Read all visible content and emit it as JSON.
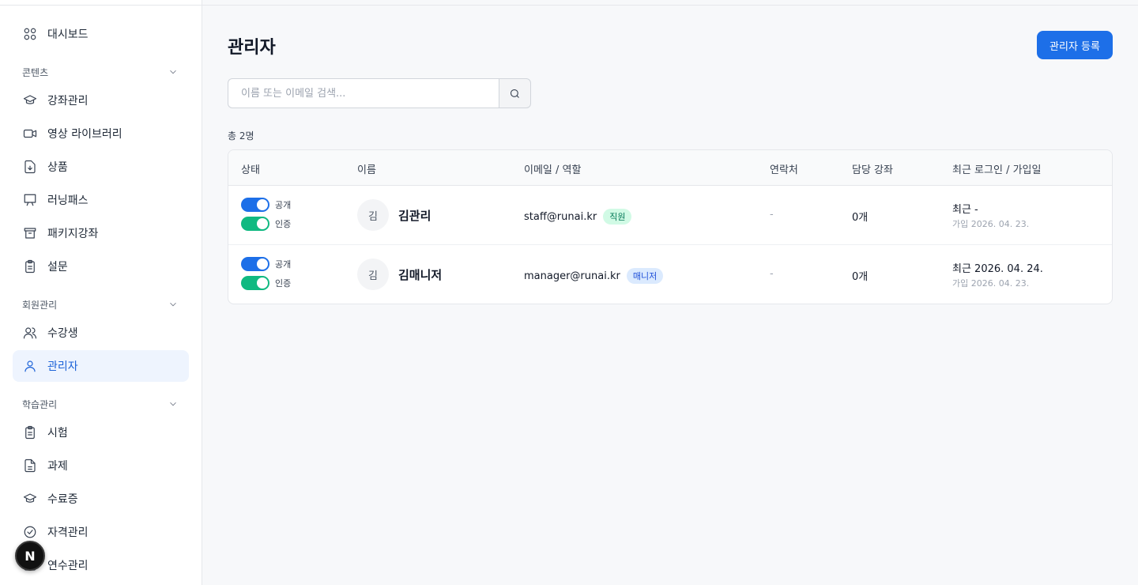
{
  "sidebar": {
    "dashboard": "대시보드",
    "sections": {
      "content": "콘텐츠",
      "members": "회원관리",
      "learning": "학습관리"
    },
    "items": [
      {
        "label": "강좌관리",
        "icon": "graduation-cap-icon"
      },
      {
        "label": "영상 라이브러리",
        "icon": "video-icon"
      },
      {
        "label": "상품",
        "icon": "file-download-icon"
      },
      {
        "label": "러닝패스",
        "icon": "presentation-icon"
      },
      {
        "label": "패키지강좌",
        "icon": "archive-icon"
      },
      {
        "label": "설문",
        "icon": "clipboard-icon"
      },
      {
        "label": "수강생",
        "icon": "users-icon"
      },
      {
        "label": "관리자",
        "icon": "user-icon"
      },
      {
        "label": "시험",
        "icon": "clipboard-icon"
      },
      {
        "label": "과제",
        "icon": "file-text-icon"
      },
      {
        "label": "수료증",
        "icon": "graduation-cap-icon"
      },
      {
        "label": "자격관리",
        "icon": "check-circle-icon"
      },
      {
        "label": "연수관리",
        "icon": "briefcase-icon"
      }
    ]
  },
  "floating_badge": "N",
  "page": {
    "title": "관리자",
    "register_button": "관리자 등록",
    "search_placeholder": "이름 또는 이메일 검색...",
    "count": "총 2명"
  },
  "table": {
    "headers": [
      "상태",
      "이름",
      "이메일 / 역할",
      "연락처",
      "담당 강좌",
      "최근 로그인 / 가입일"
    ],
    "toggle_labels": {
      "public": "공개",
      "verified": "인증"
    },
    "rows": [
      {
        "avatar": "김",
        "name": "김관리",
        "email": "staff@runai.kr",
        "role": "직원",
        "phone": "-",
        "courses": "0개",
        "recent": "최근 -",
        "joined": "가입 2026. 04. 23."
      },
      {
        "avatar": "김",
        "name": "김매니저",
        "email": "manager@runai.kr",
        "role": "매니저",
        "phone": "-",
        "courses": "0개",
        "recent": "최근 2026. 04. 24.",
        "joined": "가입 2026. 04. 23."
      }
    ]
  },
  "colors": {
    "accent": "#1d6fe8",
    "toggle_green": "#10b981",
    "active_nav_bg": "#eef4fe"
  }
}
